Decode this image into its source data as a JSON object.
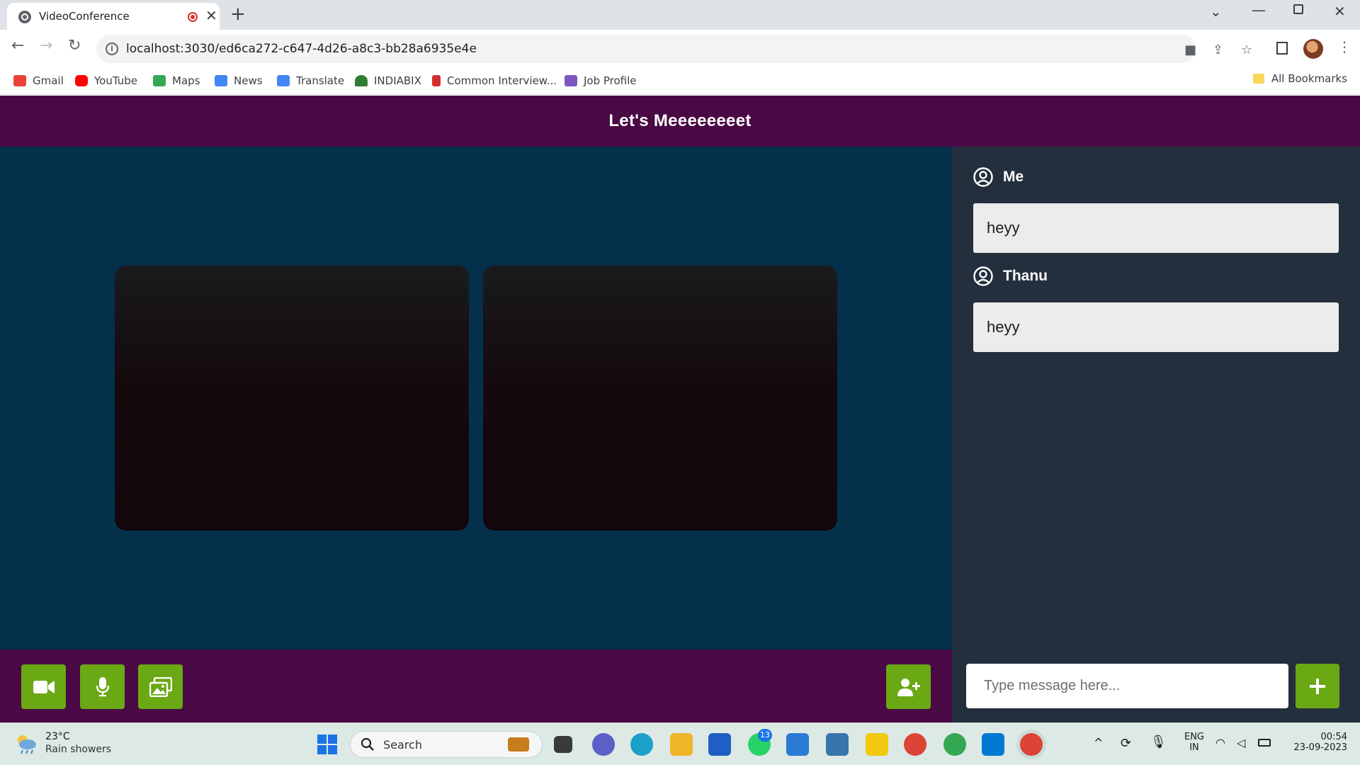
{
  "browser": {
    "tab_title": "VideoConference",
    "url": "localhost:3030/ed6ca272-c647-4d26-a8c3-bb28a6935e4e",
    "new_tab_symbol": "+",
    "close_tab_symbol": "✕",
    "bookmarks": [
      {
        "label": "Gmail",
        "icon_color": "#ea4335"
      },
      {
        "label": "YouTube",
        "icon_color": "#ff0000"
      },
      {
        "label": "Maps",
        "icon_color": "#34a853"
      },
      {
        "label": "News",
        "icon_color": "#4285f4"
      },
      {
        "label": "Translate",
        "icon_color": "#4285f4"
      },
      {
        "label": "INDIABIX",
        "icon_color": "#2e7d32"
      },
      {
        "label": "Common Interview...",
        "icon_color": "#d32f2f"
      },
      {
        "label": "Job Profile",
        "icon_color": "#7e57c2"
      }
    ],
    "all_bookmarks_label": "All Bookmarks"
  },
  "app": {
    "title": "Let's Meeeeeeeet",
    "accent_color": "#6aa814",
    "header_color": "#4a0844",
    "stage_color": "#04304b",
    "controls": [
      {
        "name": "video-toggle",
        "icon": "video-camera-icon"
      },
      {
        "name": "mic-toggle",
        "icon": "microphone-icon"
      },
      {
        "name": "screen-share",
        "icon": "photos-icon"
      }
    ],
    "invite_icon": "add-user-icon",
    "chat": {
      "messages": [
        {
          "author": "Me",
          "text": "heyy"
        },
        {
          "author": "Thanu",
          "text": "heyy"
        }
      ],
      "input_placeholder": "Type message here...",
      "send_icon": "plus-icon"
    }
  },
  "taskbar": {
    "weather_temp": "23°C",
    "weather_condition": "Rain showers",
    "search_label": "Search",
    "whatsapp_badge": "13",
    "language_line1": "ENG",
    "language_line2": "IN",
    "time": "00:54",
    "date": "23-09-2023"
  }
}
